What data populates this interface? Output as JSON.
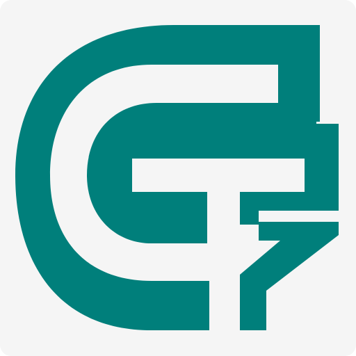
{
  "colors": {
    "background": "#f5f5f5",
    "mark": "#007f7b"
  },
  "icon": {
    "name": "monogram-logo-icon"
  }
}
